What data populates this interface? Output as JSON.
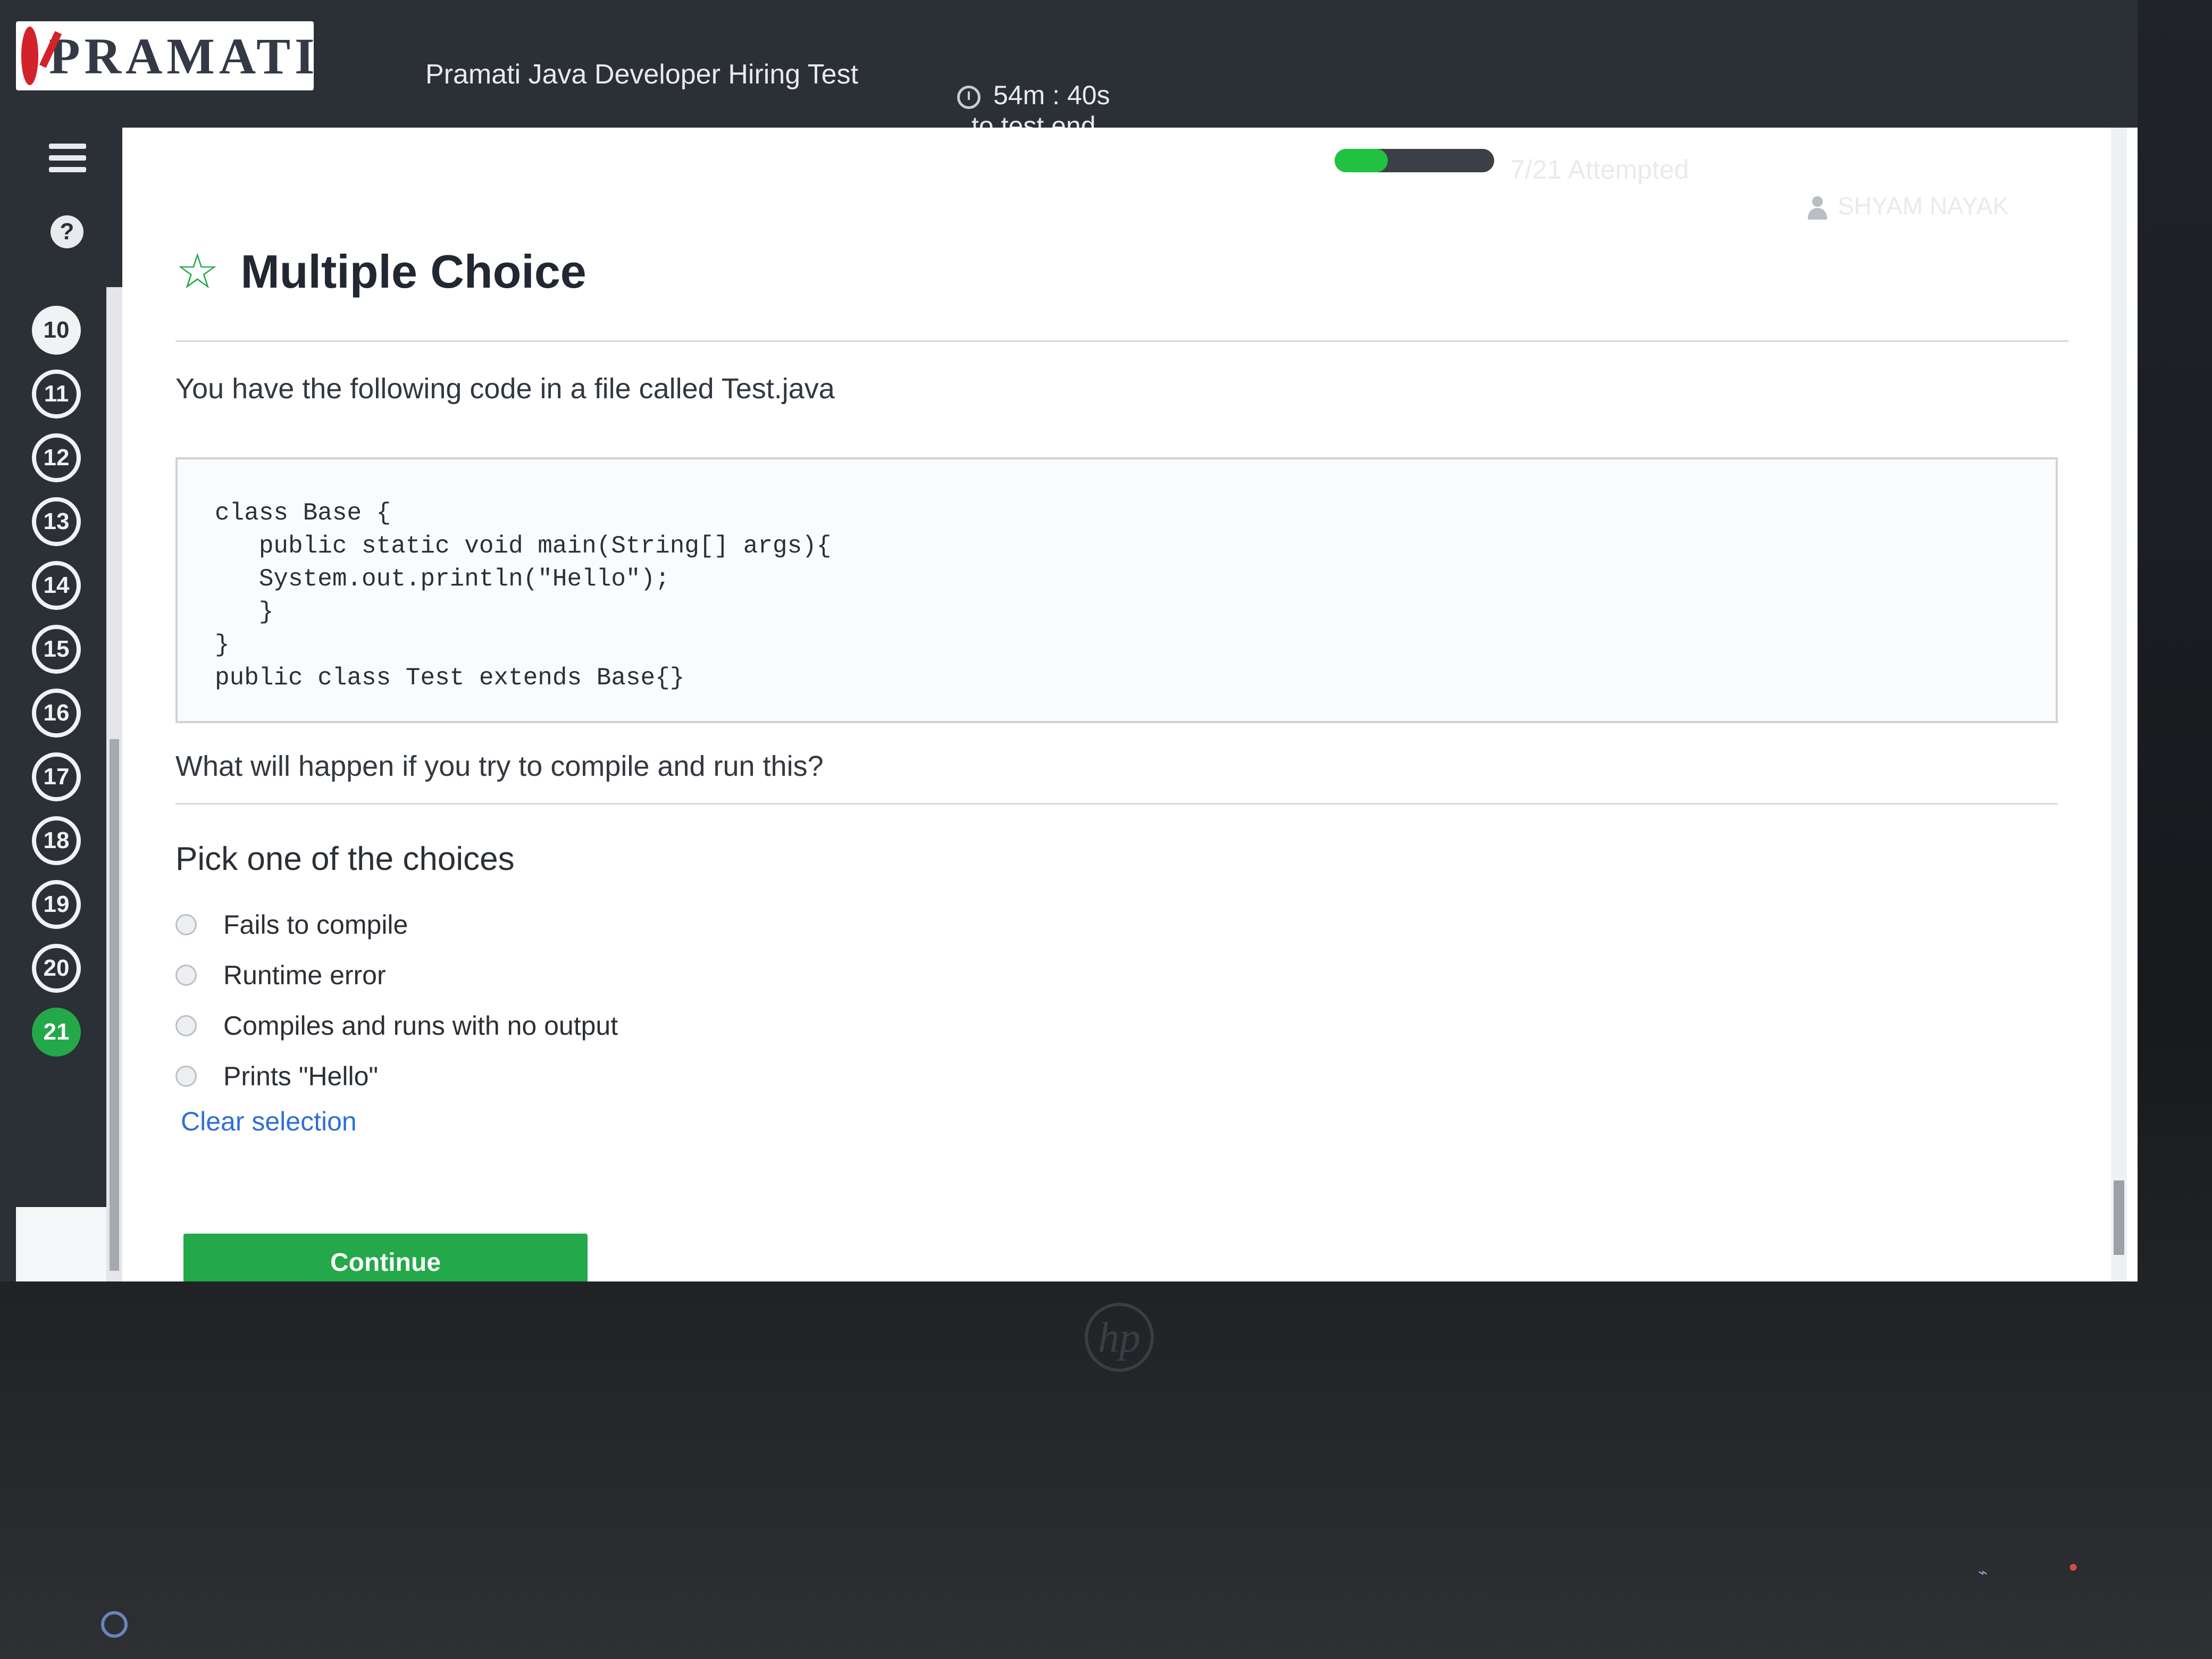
{
  "header": {
    "logo_text": "PRAMATI",
    "test_title": "Pramati Java Developer Hiring Test",
    "timer_value": "54m : 40s",
    "timer_suffix": "to test end",
    "progress_fraction": 0.333,
    "attempted_label": "7/21 Attempted",
    "user_name": "SHYAM NAYAK"
  },
  "sidebar": {
    "help_label": "?",
    "questions": [
      "10",
      "11",
      "12",
      "13",
      "14",
      "15",
      "16",
      "17",
      "18",
      "19",
      "20",
      "21"
    ],
    "current": "21"
  },
  "main": {
    "section_title": "Multiple Choice",
    "prompt": "You have the following code in a file called Test.java",
    "code": "class Base {\n   public static void main(String[] args){\n   System.out.println(\"Hello\");\n   }\n}\npublic class Test extends Base{}",
    "question": "What will happen if you try to compile and run this?",
    "pick_label": "Pick one of the choices",
    "choices": [
      "Fails to compile",
      "Runtime error",
      "Compiles and runs with no output",
      "Prints \"Hello\""
    ],
    "clear_label": "Clear selection",
    "continue_label": "Continue"
  },
  "device": {
    "brand_mark": "hp"
  },
  "colors": {
    "accent_green": "#23a84a",
    "header_bg": "#2b2f36",
    "link_blue": "#2f6fd6",
    "logo_red": "#d2232a"
  }
}
